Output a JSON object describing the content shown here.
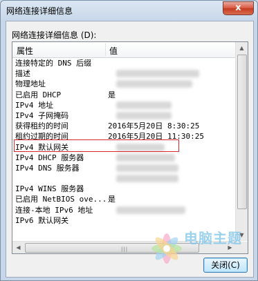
{
  "window": {
    "title": "网络连接详细信息",
    "close_glyph": "x"
  },
  "section_label": "网络连接详细信息 (D):",
  "table": {
    "headers": [
      "属性",
      "值"
    ],
    "rows": [
      {
        "prop": "连接特定的 DNS 后缀",
        "value": ""
      },
      {
        "prop": "描述",
        "value": ""
      },
      {
        "prop": "物理地址",
        "value": ""
      },
      {
        "prop": "已启用 DHCP",
        "value": "是"
      },
      {
        "prop": "IPv4 地址",
        "value": ""
      },
      {
        "prop": "IPv4 子网掩码",
        "value": ""
      },
      {
        "prop": "获得租约的时间",
        "value": "2016年5月20日 8:30:25"
      },
      {
        "prop": "租约过期的时间",
        "value": "2016年5月20日 11:30:25"
      },
      {
        "prop": "IPv4 默认网关",
        "value": ""
      },
      {
        "prop": "IPv4 DHCP 服务器",
        "value": ""
      },
      {
        "prop": "IPv4 DNS 服务器",
        "value": ""
      },
      {
        "prop": "",
        "value": ""
      },
      {
        "prop": "IPv4 WINS 服务器",
        "value": ""
      },
      {
        "prop": "已启用 NetBIOS ove...",
        "value": "是"
      },
      {
        "prop": "连接-本地 IPv6 地址",
        "value": ""
      },
      {
        "prop": "IPv6 默认网关",
        "value": ""
      }
    ]
  },
  "close_button_label": "关闭(C)",
  "watermark_text": "电脑主题",
  "colors": {
    "highlight": "#d9262b",
    "button_border": "#3c7fb1"
  }
}
